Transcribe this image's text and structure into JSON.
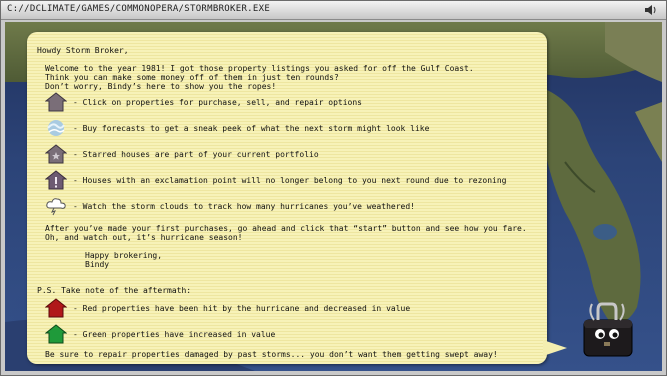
{
  "window": {
    "title": "C://DCLIMATE/GAMES/COMMONOPERA/STORMBROKER.EXE",
    "speaker_icon": "speaker-icon"
  },
  "note": {
    "greeting": "Howdy Storm Broker,",
    "intro_lines": [
      "Welcome to the year 1981! I got those property listings you asked for off the Gulf Coast.",
      "Think you can make some money off of them in just ten rounds?",
      "Don’t worry, Bindy’s here to show you the ropes!"
    ],
    "legend": [
      {
        "icon": "house-icon",
        "text": "- Click on properties for purchase, sell, and repair options"
      },
      {
        "icon": "forecast-icon",
        "text": "- Buy forecasts to get a sneak peek of what the next storm might look like"
      },
      {
        "icon": "starred-house-icon",
        "text": "- Starred houses are part of your current portfolio"
      },
      {
        "icon": "exclamation-house-icon",
        "text": "- Houses with an exclamation point will no longer belong to you next round due to rezoning"
      },
      {
        "icon": "storm-cloud-icon",
        "text": "- Watch the storm clouds to track how many hurricanes you’ve weathered!"
      }
    ],
    "closing_lines": [
      "After you’ve made your first purchases, go ahead and click that “start” button and see how you fare.",
      "Oh, and watch out, it’s hurricane season!"
    ],
    "signoff": "Happy brokering,",
    "signature": "Bindy",
    "ps_title": "P.S. Take note of the aftermath:",
    "aftermath": [
      {
        "icon": "red-house-icon",
        "text": "- Red properties have been hit by the hurricane and decreased in value"
      },
      {
        "icon": "green-house-icon",
        "text": "- Green properties have increased in value"
      }
    ],
    "final_line": "Be sure to repair properties damaged by past storms... you don’t want them getting swept away!"
  },
  "colors": {
    "house": "#7a6e78",
    "red_house": "#b0181a",
    "green_house": "#1f9a3a",
    "note_bg": "#f7f2b8",
    "exclaim_house": "#6d5a72"
  }
}
